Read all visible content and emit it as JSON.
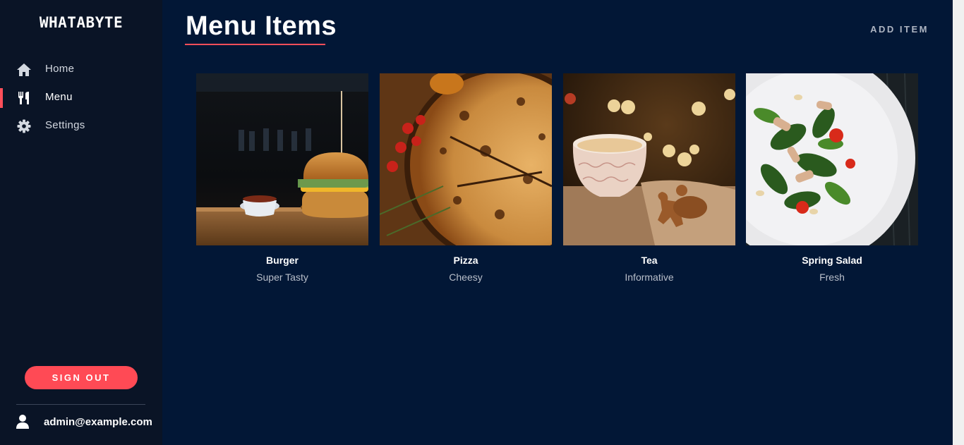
{
  "brand": "WHATABYTE",
  "colors": {
    "sidebar": "#0a1426",
    "main": "#021736",
    "accent": "#ff4f5a"
  },
  "nav": {
    "items": [
      {
        "label": "Home",
        "icon": "home-icon"
      },
      {
        "label": "Menu",
        "icon": "utensils-icon",
        "active": true
      },
      {
        "label": "Settings",
        "icon": "gear-icon"
      }
    ]
  },
  "signout_label": "SIGN OUT",
  "user": {
    "email": "admin@example.com",
    "icon": "user-icon"
  },
  "header": {
    "title": "Menu Items",
    "add_label": "ADD ITEM"
  },
  "menu_items": [
    {
      "name": "Burger",
      "description": "Super Tasty",
      "image": "burger-photo"
    },
    {
      "name": "Pizza",
      "description": "Cheesy",
      "image": "pizza-photo"
    },
    {
      "name": "Tea",
      "description": "Informative",
      "image": "tea-photo"
    },
    {
      "name": "Spring Salad",
      "description": "Fresh",
      "image": "salad-photo"
    }
  ]
}
